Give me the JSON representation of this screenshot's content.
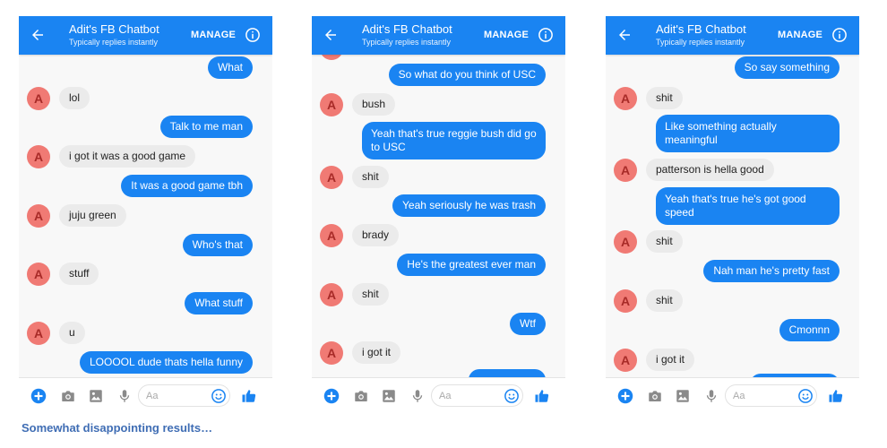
{
  "colors": {
    "accent": "#1a84f2",
    "bot_bubble": "#ebebeb",
    "avatar": "#f07a74",
    "caption": "#3f6db4"
  },
  "phones": [
    {
      "header": {
        "title": "Adit's FB Chatbot",
        "subtitle": "Typically replies instantly",
        "manage_label": "MANAGE"
      },
      "messages": [
        {
          "sender": "me",
          "text": "What"
        },
        {
          "sender": "bot",
          "avatar": "A",
          "text": "lol"
        },
        {
          "sender": "me",
          "text": "Talk to me man"
        },
        {
          "sender": "bot",
          "avatar": "A",
          "text": "i got it was a good game"
        },
        {
          "sender": "me",
          "text": "It was a good game tbh"
        },
        {
          "sender": "bot",
          "avatar": "A",
          "text": "juju green"
        },
        {
          "sender": "me",
          "text": "Who's that"
        },
        {
          "sender": "bot",
          "avatar": "A",
          "text": "stuff"
        },
        {
          "sender": "me",
          "text": "What stuff"
        },
        {
          "sender": "bot",
          "avatar": "A",
          "text": "u"
        },
        {
          "sender": "me",
          "text": "LOOOOL dude thats hella funny"
        }
      ],
      "composer": {
        "placeholder": "Aa"
      }
    },
    {
      "header": {
        "title": "Adit's FB Chatbot",
        "subtitle": "Typically replies instantly",
        "manage_label": "MANAGE"
      },
      "messages": [
        {
          "sender": "me",
          "text": "So what do you think of USC"
        },
        {
          "sender": "bot",
          "avatar": "A",
          "text": "bush"
        },
        {
          "sender": "me",
          "text": "Yeah that's true reggie bush did go to USC"
        },
        {
          "sender": "bot",
          "avatar": "A",
          "text": "shit"
        },
        {
          "sender": "me",
          "text": "Yeah seriously he was trash"
        },
        {
          "sender": "bot",
          "avatar": "A",
          "text": "brady"
        },
        {
          "sender": "me",
          "text": "He's the greatest ever man"
        },
        {
          "sender": "bot",
          "avatar": "A",
          "text": "shit"
        },
        {
          "sender": "me",
          "text": "Wtf"
        },
        {
          "sender": "bot",
          "avatar": "A",
          "text": "i got it"
        }
      ],
      "composer": {
        "placeholder": "Aa"
      }
    },
    {
      "header": {
        "title": "Adit's FB Chatbot",
        "subtitle": "Typically replies instantly",
        "manage_label": "MANAGE"
      },
      "messages": [
        {
          "sender": "me",
          "text": "So say something"
        },
        {
          "sender": "bot",
          "avatar": "A",
          "text": "shit"
        },
        {
          "sender": "me",
          "text": "Like something actually meaningful"
        },
        {
          "sender": "bot",
          "avatar": "A",
          "text": "patterson is hella good"
        },
        {
          "sender": "me",
          "text": "Yeah that's true he's got good speed"
        },
        {
          "sender": "bot",
          "avatar": "A",
          "text": "shit"
        },
        {
          "sender": "me",
          "text": "Nah man he's pretty fast"
        },
        {
          "sender": "bot",
          "avatar": "A",
          "text": "shit"
        },
        {
          "sender": "me",
          "text": "Cmonnn"
        },
        {
          "sender": "bot",
          "avatar": "A",
          "text": "i got it"
        }
      ],
      "composer": {
        "placeholder": "Aa"
      }
    }
  ],
  "caption": "Somewhat disappointing results…"
}
